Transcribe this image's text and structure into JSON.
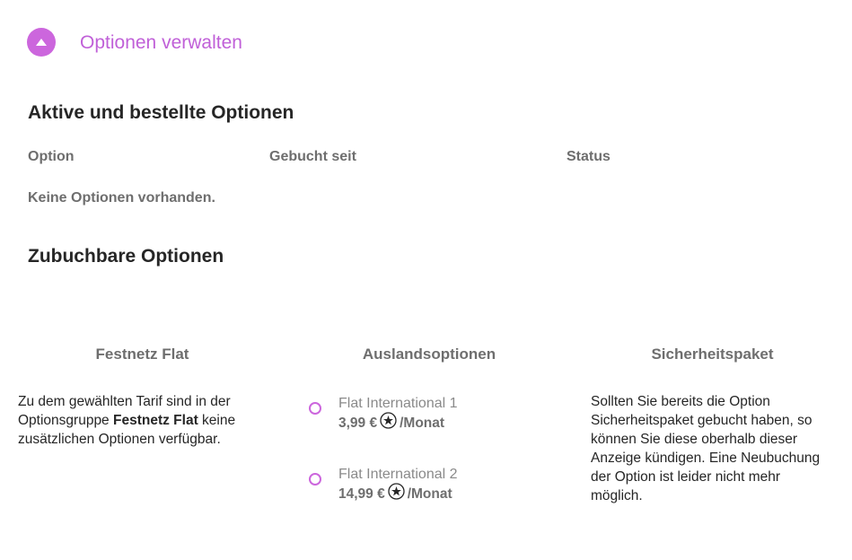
{
  "header": {
    "title": "Optionen verwalten",
    "toggle_icon": "chevron-up-icon",
    "accent_color": "#cc66dd"
  },
  "active": {
    "heading": "Aktive und bestellte Optionen",
    "columns": [
      "Option",
      "Gebucht seit",
      "Status"
    ],
    "empty_message": "Keine Optionen vorhanden."
  },
  "bookable": {
    "heading": "Zubuchbare Optionen",
    "groups": [
      {
        "title": "Festnetz Flat",
        "text_before": "Zu dem gewählten Tarif sind in der Optionsgruppe ",
        "text_bold": "Festnetz Flat",
        "text_after": " keine zusätzlichen Optionen verfügbar."
      },
      {
        "title": "Auslandsoptionen",
        "options": [
          {
            "name": "Flat International 1",
            "price": "3,99 €",
            "period": "/Monat",
            "selected": false,
            "price_icon": "star-icon"
          },
          {
            "name": "Flat International 2",
            "price": "14,99 €",
            "period": "/Monat",
            "selected": false,
            "price_icon": "star-icon"
          }
        ]
      },
      {
        "title": "Sicherheitspaket",
        "text": "Sollten Sie bereits die Option Sicherheitspaket gebucht haben, so können Sie diese oberhalb dieser Anzeige kündigen. Eine Neubuchung der Option ist leider nicht mehr möglich."
      }
    ]
  }
}
